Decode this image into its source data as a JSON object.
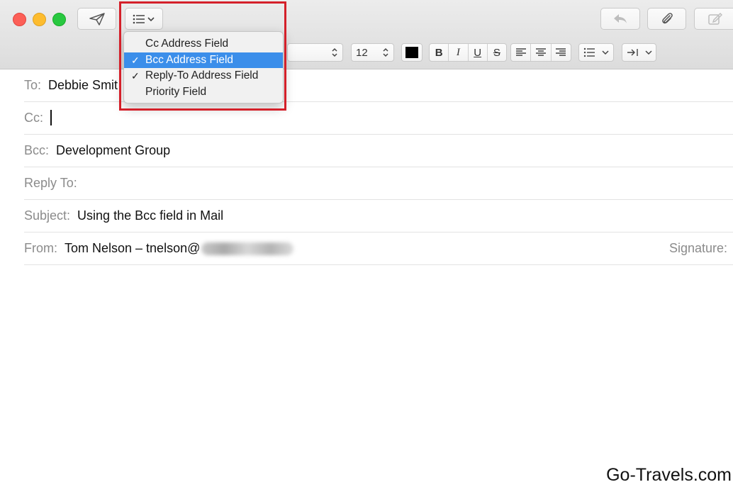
{
  "window": {
    "controls": [
      "close",
      "minimize",
      "zoom"
    ],
    "colors": {
      "close": "#fc5f57",
      "minimize": "#fdbc2e",
      "zoom": "#28c840"
    }
  },
  "toolbar": {
    "send_icon": "paper-plane-icon",
    "header_fields_icon": "list-icon",
    "reply_icon": "reply-arrow-icon",
    "attach_icon": "paperclip-icon",
    "markup_icon": "compose-icon"
  },
  "format_bar": {
    "font_size": "12",
    "text_color": "#000000",
    "bold": "B",
    "italic": "I",
    "underline": "U",
    "strikethrough": "S"
  },
  "menu": {
    "items": [
      {
        "label": "Cc Address Field",
        "checked": false,
        "selected": false
      },
      {
        "label": "Bcc Address Field",
        "checked": true,
        "selected": true
      },
      {
        "label": "Reply-To Address Field",
        "checked": true,
        "selected": false
      },
      {
        "label": "Priority Field",
        "checked": false,
        "selected": false
      }
    ],
    "checkmark": "✓",
    "highlight_color": "#3b8eea",
    "annotation_color": "#d4202a"
  },
  "fields": {
    "to": {
      "label": "To:",
      "value": "Debbie Smit"
    },
    "cc": {
      "label": "Cc:",
      "value": ""
    },
    "bcc": {
      "label": "Bcc:",
      "value": "Development Group"
    },
    "reply_to": {
      "label": "Reply To:",
      "value": ""
    },
    "subject": {
      "label": "Subject:",
      "value": "Using the Bcc field in Mail"
    },
    "from": {
      "label": "From:",
      "value": "Tom Nelson – tnelson@"
    },
    "signature": {
      "label": "Signature:"
    }
  },
  "watermark": "Go-Travels.com"
}
